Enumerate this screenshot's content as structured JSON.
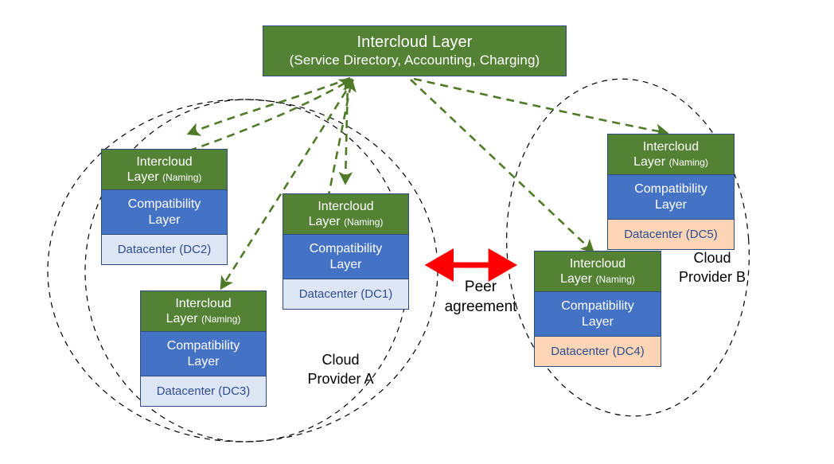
{
  "diagram": {
    "title_box": {
      "line1": "Intercloud Layer",
      "line2": "(Service Directory, Accounting, Charging)"
    },
    "layer_labels": {
      "intercloud_main": "Intercloud",
      "intercloud_second": "Layer",
      "intercloud_naming": "(Naming)",
      "compatibility_line1": "Compatibility",
      "compatibility_line2": "Layer"
    },
    "stacks": [
      {
        "id": "dc2",
        "intercloud_line1": "Intercloud",
        "intercloud_line2": "Layer",
        "intercloud_suffix": "(Naming)",
        "compat_line1": "Compatibility",
        "compat_line2": "Layer",
        "datacenter": "Datacenter (DC2)",
        "datacenter_color": "#dce6f4"
      },
      {
        "id": "dc1",
        "intercloud_line1": "Intercloud",
        "intercloud_line2": "Layer",
        "intercloud_suffix": "(Naming)",
        "compat_line1": "Compatibility",
        "compat_line2": "Layer",
        "datacenter": "Datacenter (DC1)",
        "datacenter_color": "#dce6f4"
      },
      {
        "id": "dc3",
        "intercloud_line1": "Intercloud",
        "intercloud_line2": "Layer",
        "intercloud_suffix": "(Naming)",
        "compat_line1": "Compatibility",
        "compat_line2": "Layer",
        "datacenter": "Datacenter (DC3)",
        "datacenter_color": "#dce6f4"
      },
      {
        "id": "dc5",
        "intercloud_line1": "Intercloud",
        "intercloud_line2": "Layer",
        "intercloud_suffix": "(Naming)",
        "compat_line1": "Compatibility",
        "compat_line2": "Layer",
        "datacenter": "Datacenter (DC5)",
        "datacenter_color": "#fbd5b5"
      },
      {
        "id": "dc4",
        "intercloud_line1": "Intercloud",
        "intercloud_line2": "Layer",
        "intercloud_suffix": "(Naming)",
        "compat_line1": "Compatibility",
        "compat_line2": "Layer",
        "datacenter": "Datacenter (DC4)",
        "datacenter_color": "#fbd5b5"
      }
    ],
    "groups": {
      "provider_a_line1": "Cloud",
      "provider_a_line2": "Provider A",
      "provider_b_line1": "Cloud",
      "provider_b_line2": "Provider B"
    },
    "peer": {
      "line1": "Peer",
      "line2": "agreement"
    },
    "colors": {
      "intercloud_green": "#548235",
      "compatibility_blue": "#4472c4",
      "datacenter_blue": "#dce6f4",
      "datacenter_peach": "#fbd5b5",
      "arrow_green": "#4f7a28",
      "peer_arrow_red": "#ff0000",
      "boundary_black": "#000000",
      "box_border": "#2f4c7e",
      "dc_text_blue": "#2f4c8f"
    }
  }
}
